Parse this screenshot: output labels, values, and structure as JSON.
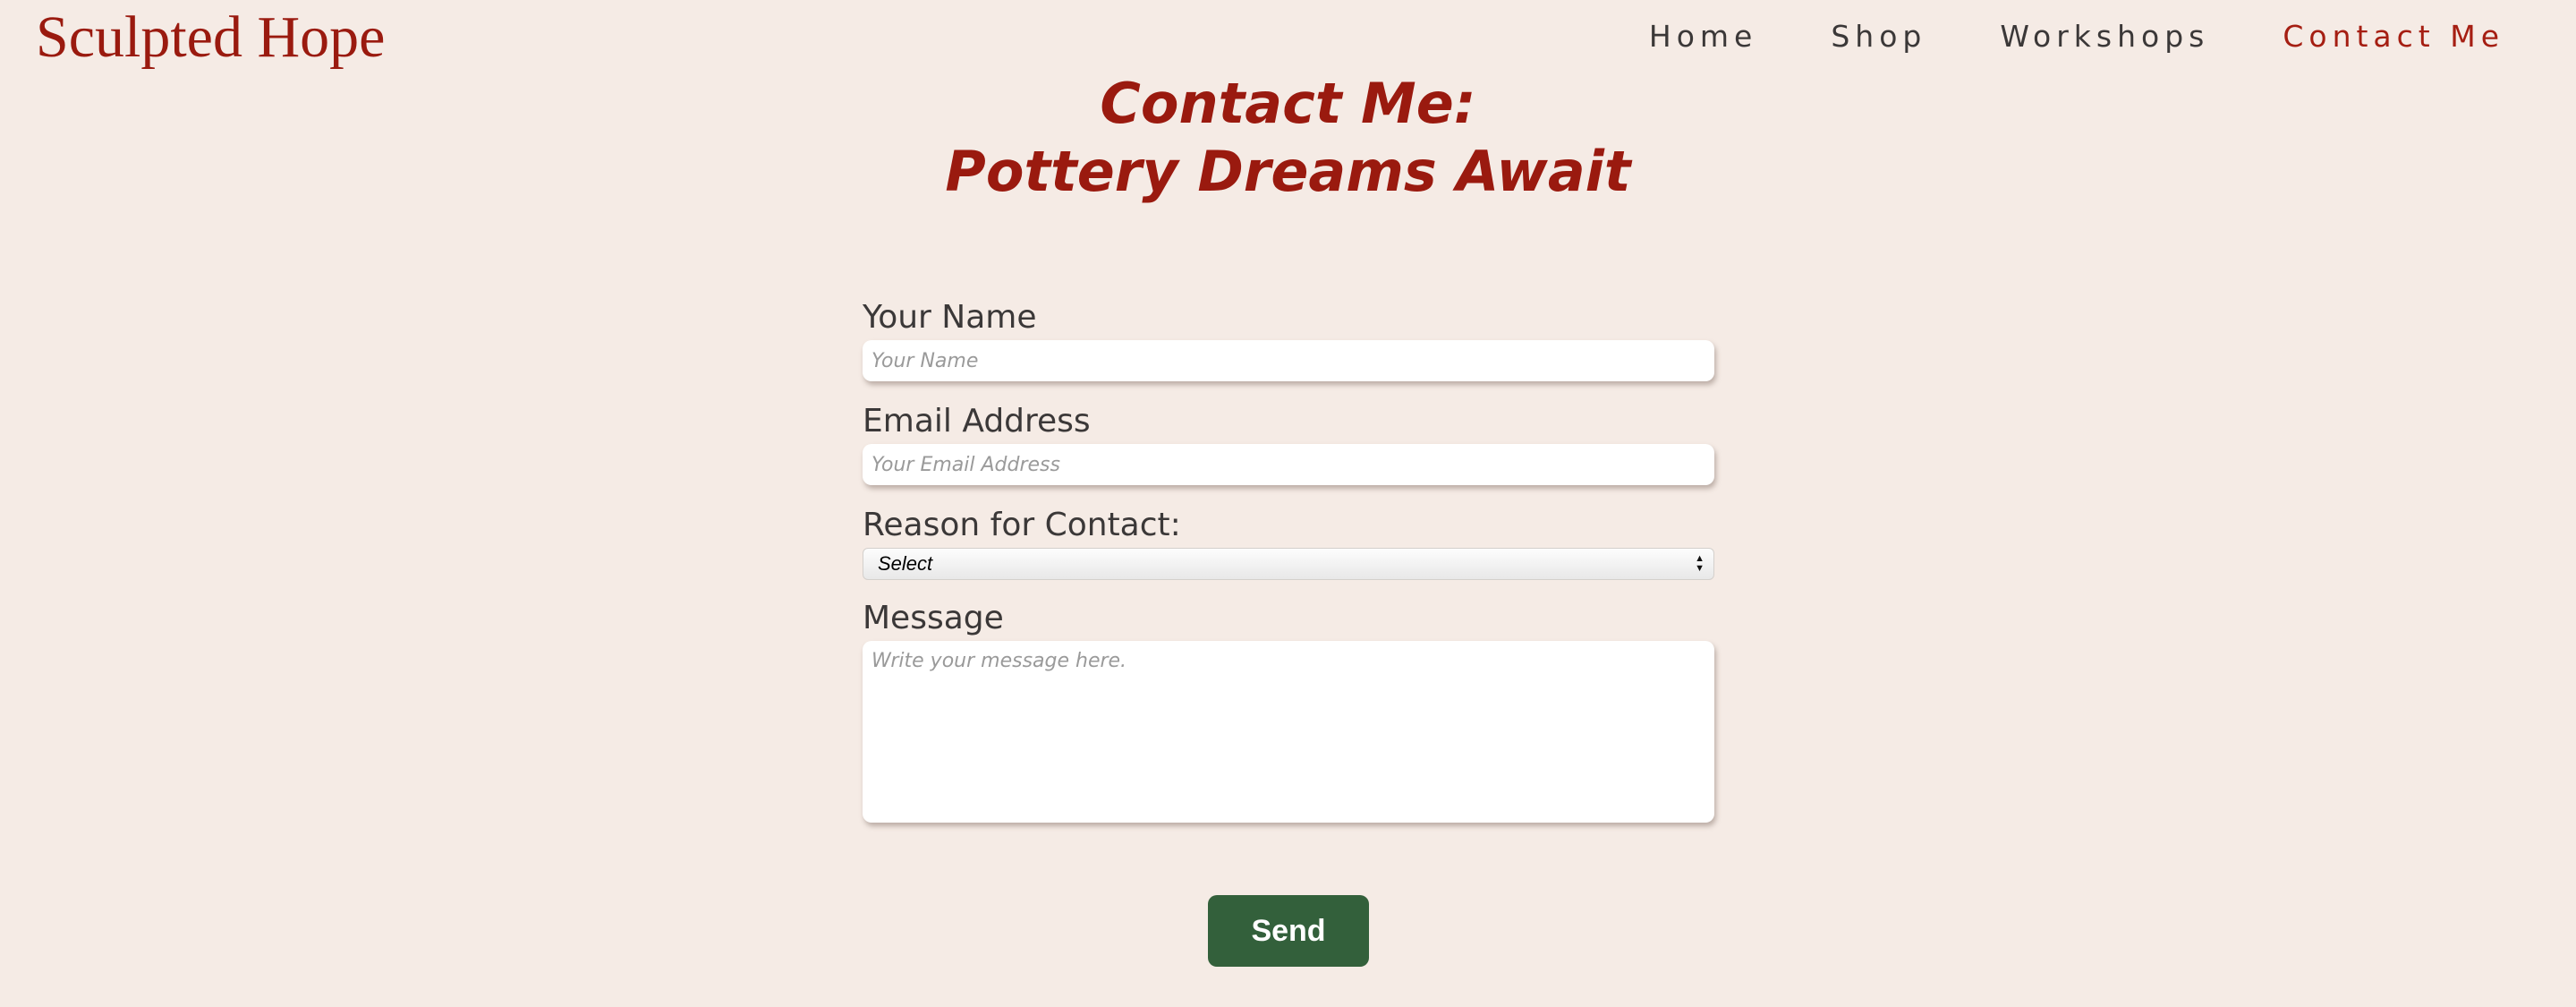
{
  "header": {
    "logo": "Sculpted Hope",
    "nav": [
      {
        "label": "Home"
      },
      {
        "label": "Shop"
      },
      {
        "label": "Workshops"
      },
      {
        "label": "Contact Me",
        "active": true
      }
    ]
  },
  "heading": {
    "line1": "Contact Me:",
    "line2": "Pottery Dreams Await"
  },
  "form": {
    "name": {
      "label": "Your Name",
      "placeholder": "Your Name"
    },
    "email": {
      "label": "Email Address",
      "placeholder": "Your Email Address"
    },
    "reason": {
      "label": "Reason for Contact:",
      "selected": "Select"
    },
    "message": {
      "label": "Message",
      "placeholder": "Write your message here."
    },
    "send_label": "Send"
  },
  "colors": {
    "background": "#f5ebe5",
    "accent": "#9a1a0f",
    "button": "#33603b"
  }
}
